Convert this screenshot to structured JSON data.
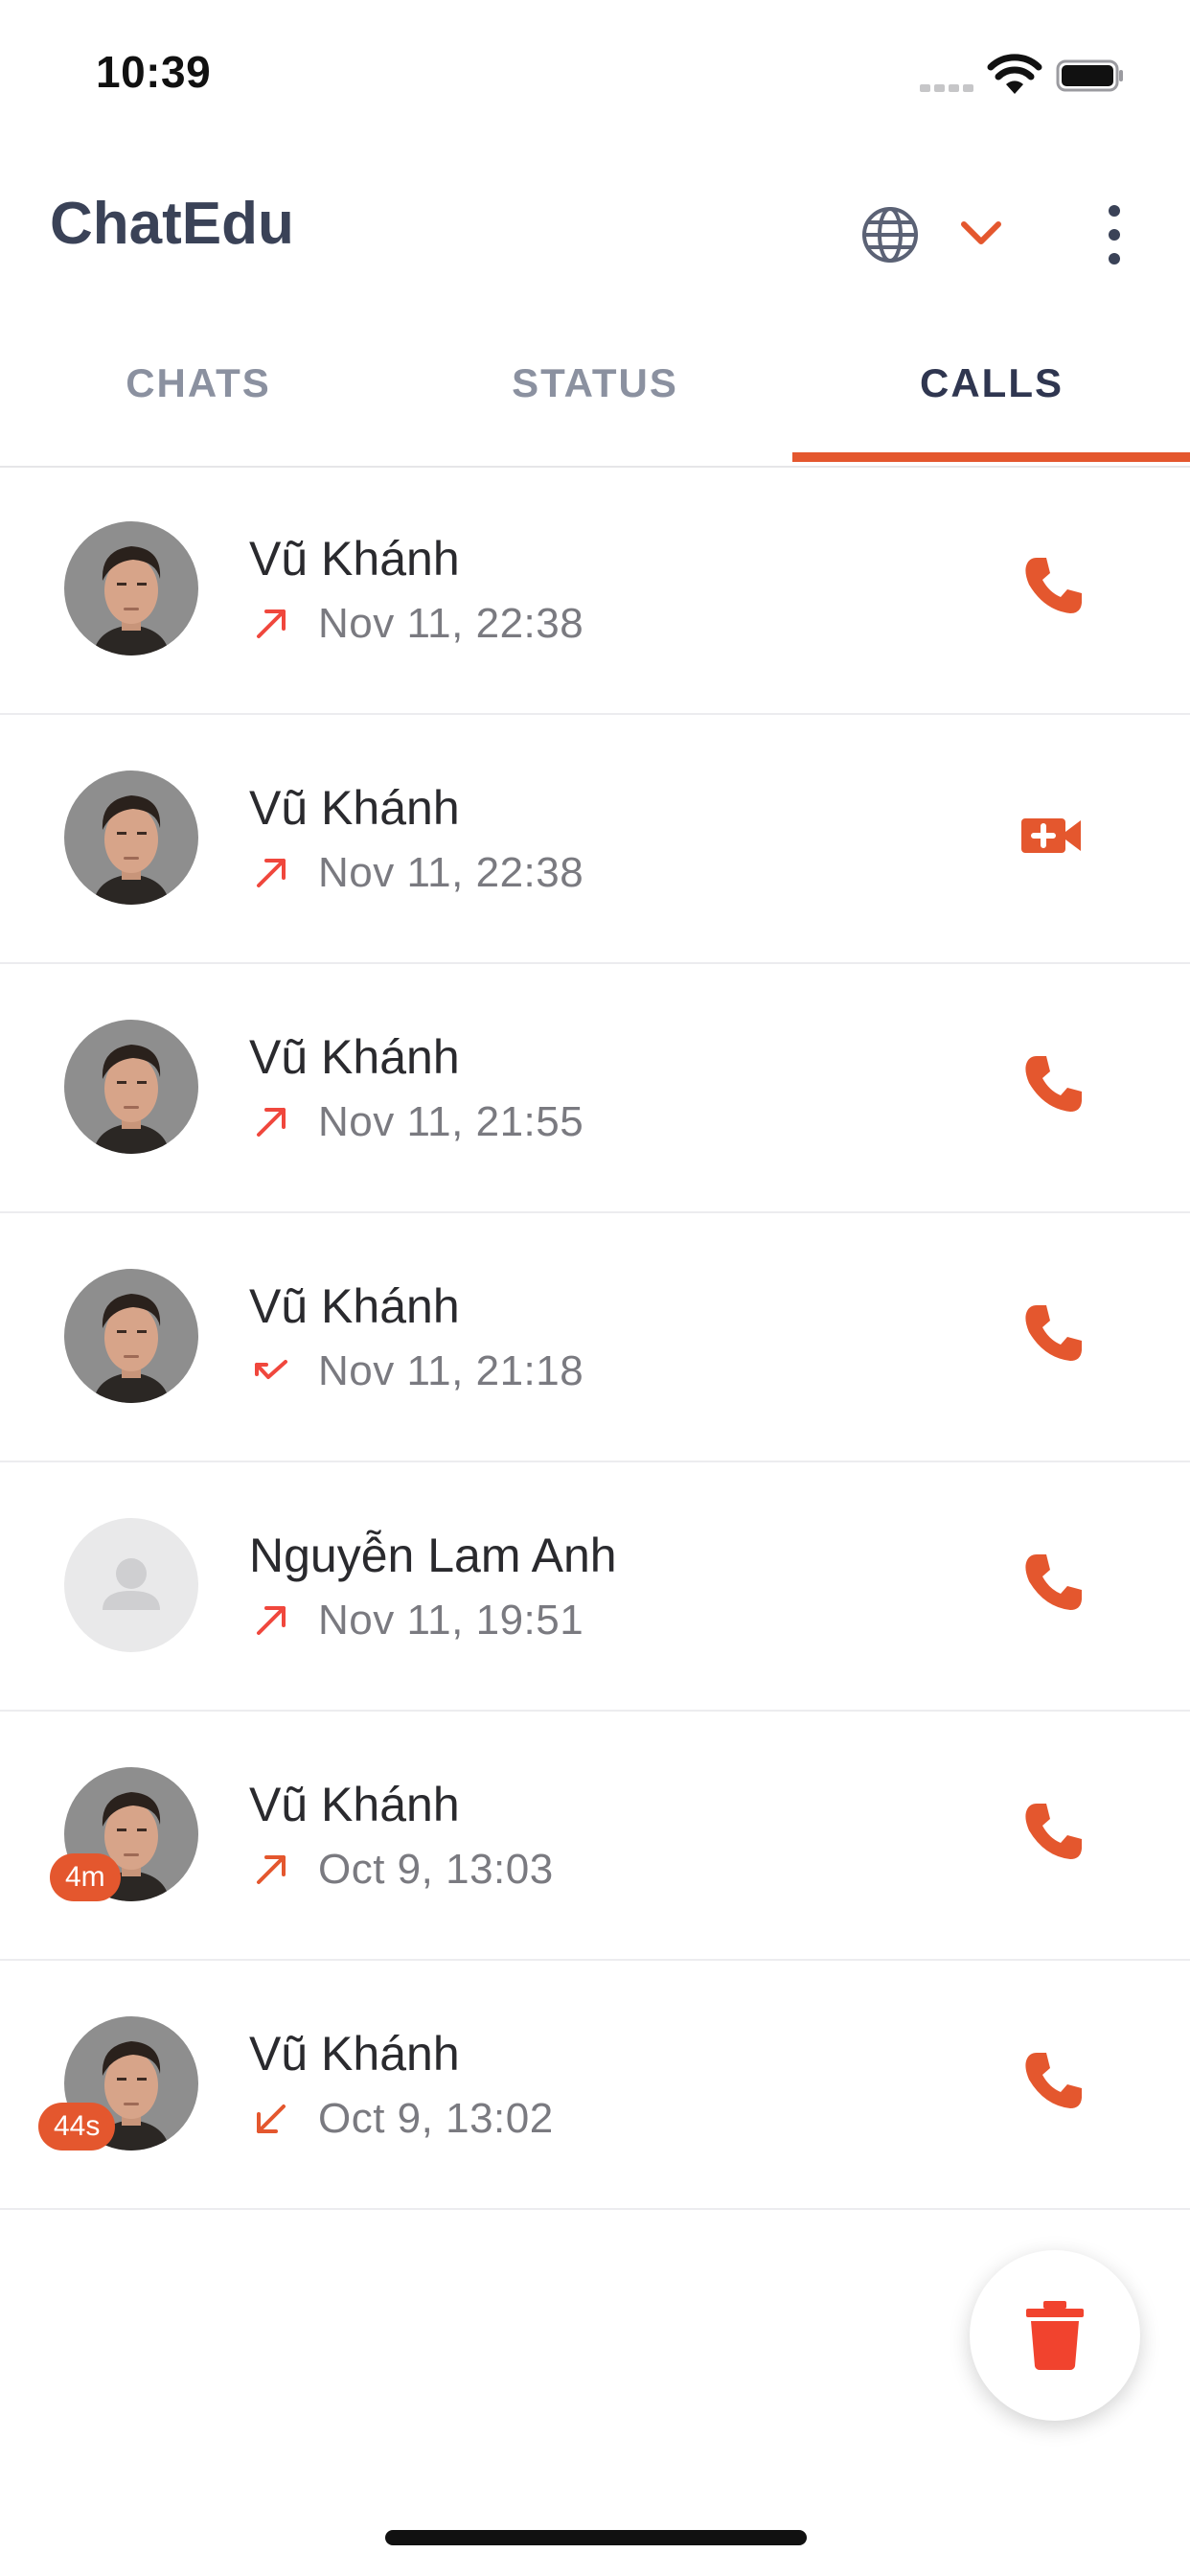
{
  "status_bar": {
    "time": "10:39"
  },
  "app": {
    "title": "ChatEdu"
  },
  "tabs": [
    {
      "label": "CHATS",
      "active": false
    },
    {
      "label": "STATUS",
      "active": false
    },
    {
      "label": "CALLS",
      "active": true
    }
  ],
  "calls": [
    {
      "name": "Vũ Khánh",
      "time": "Nov 11, 22:38",
      "direction": "outgoing",
      "type": "voice",
      "avatar": "photo",
      "duration": ""
    },
    {
      "name": "Vũ Khánh",
      "time": "Nov 11, 22:38",
      "direction": "outgoing",
      "type": "video",
      "avatar": "photo",
      "duration": ""
    },
    {
      "name": "Vũ Khánh",
      "time": "Nov 11, 21:55",
      "direction": "outgoing",
      "type": "voice",
      "avatar": "photo",
      "duration": ""
    },
    {
      "name": "Vũ Khánh",
      "time": "Nov 11, 21:18",
      "direction": "missed",
      "type": "voice",
      "avatar": "photo",
      "duration": ""
    },
    {
      "name": "Nguyễn Lam Anh",
      "time": "Nov 11, 19:51",
      "direction": "outgoing",
      "type": "voice",
      "avatar": "placeholder",
      "duration": ""
    },
    {
      "name": "Vũ Khánh",
      "time": "Oct 9, 13:03",
      "direction": "outgoing-answered",
      "type": "voice",
      "avatar": "photo",
      "duration": "4m"
    },
    {
      "name": "Vũ Khánh",
      "time": "Oct 9, 13:02",
      "direction": "incoming-answered",
      "type": "voice",
      "avatar": "photo",
      "duration": "44s"
    }
  ],
  "colors": {
    "accent": "#e4572e",
    "missed_red": "#f0473d",
    "title": "#3a4257",
    "muted": "#7a7a80",
    "trash": "#f1432e"
  },
  "icons": {
    "globe": "globe-icon",
    "chevron": "chevron-down-icon",
    "more": "more-vert-icon",
    "voice": "phone-icon",
    "video": "video-add-icon",
    "delete": "trash-icon"
  }
}
